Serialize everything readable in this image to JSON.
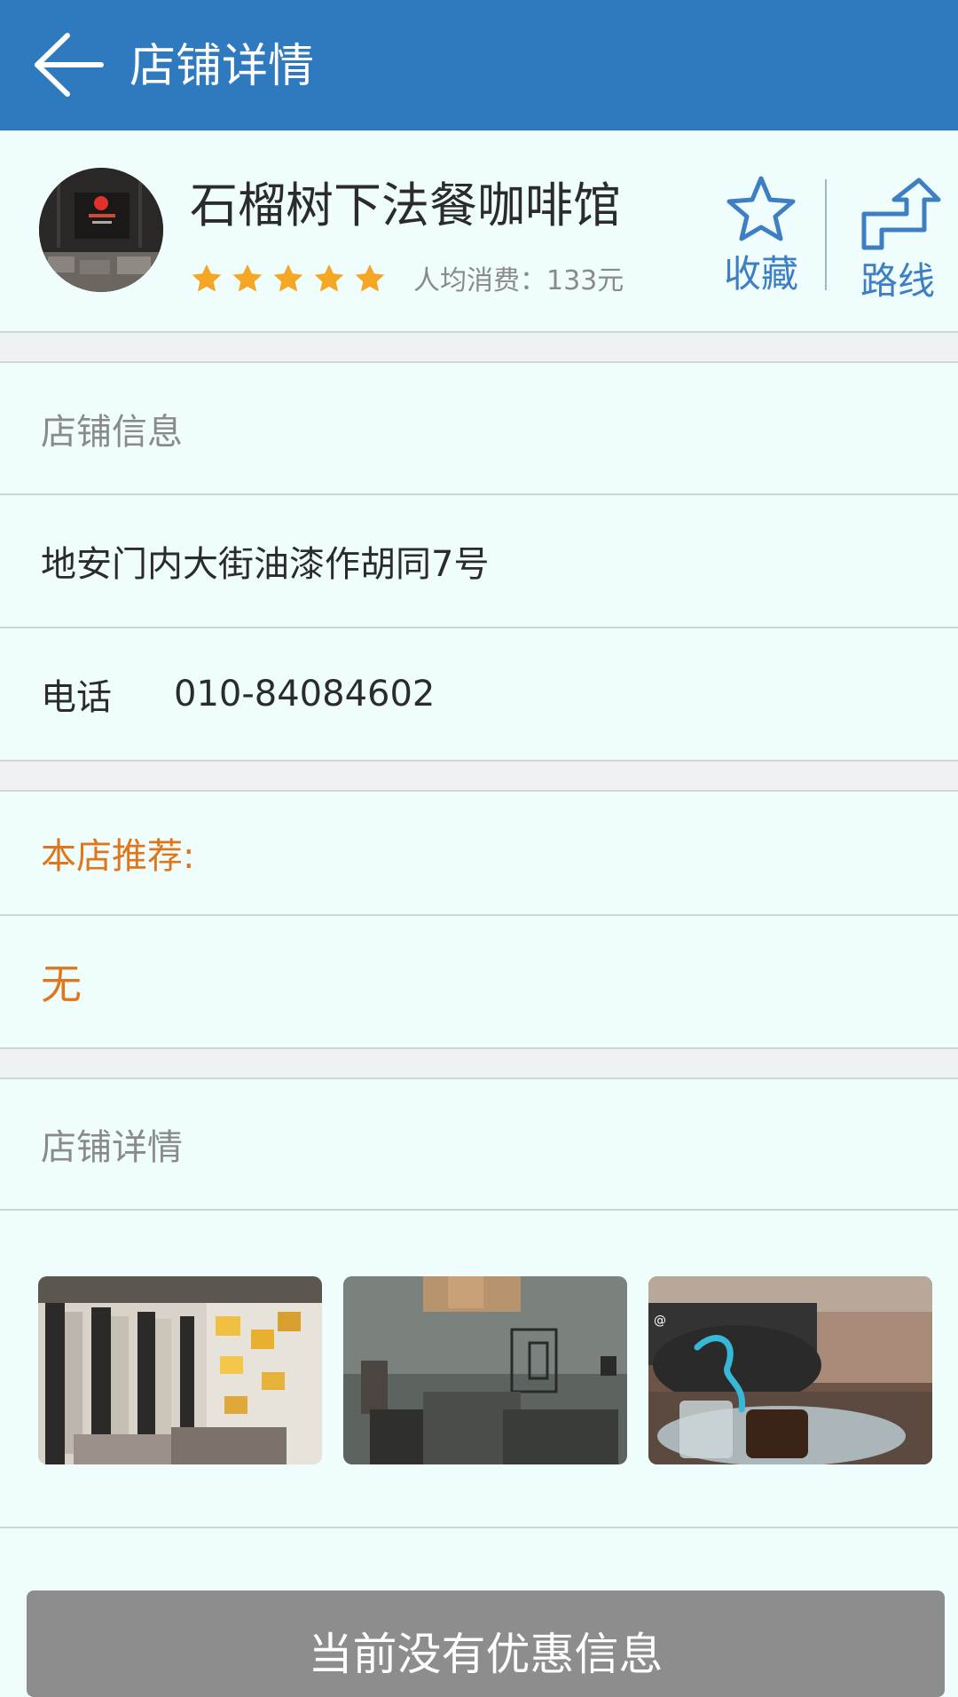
{
  "appbar": {
    "title": "店铺详情",
    "back_icon": "arrow-left-icon"
  },
  "shop": {
    "name": "石榴树下法餐咖啡馆",
    "rating": 5,
    "rating_max": 5,
    "avg_cost": "人均消费：133元",
    "favorite_label": "收藏",
    "route_label": "路线"
  },
  "info": {
    "section_label": "店铺信息",
    "address": "地安门内大街油漆作胡同7号",
    "phone_label": "电话",
    "phone_value": "010-84084602"
  },
  "recommend": {
    "label": "本店推荐:",
    "value": "无"
  },
  "details": {
    "section_label": "店铺详情"
  },
  "bottom": {
    "button_label": "当前没有优惠信息"
  },
  "colors": {
    "appbar": "#2f7abf",
    "accent_blue": "#3d7fc2",
    "star": "#f5a623",
    "orange": "#e0751a",
    "page_bg": "#f0fdfd"
  }
}
